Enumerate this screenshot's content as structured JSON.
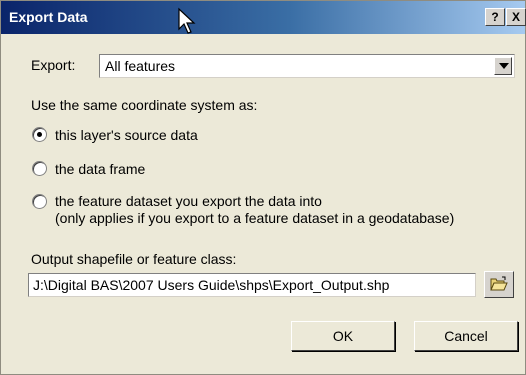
{
  "window": {
    "title": "Export Data",
    "help_label": "?",
    "close_label": "X"
  },
  "export": {
    "label": "Export:",
    "selected": "All features"
  },
  "coordinate_system": {
    "heading": "Use the same coordinate system as:",
    "options": [
      {
        "label": "this layer's source data",
        "selected": true
      },
      {
        "label": "the data frame",
        "selected": false
      },
      {
        "label": "the feature dataset you export the data into",
        "note": "(only applies if you export to a feature dataset in a geodatabase)",
        "selected": false
      }
    ]
  },
  "output": {
    "label": "Output shapefile or feature class:",
    "path": "J:\\Digital BAS\\2007 Users Guide\\shps\\Export_Output.shp"
  },
  "buttons": {
    "ok": "OK",
    "cancel": "Cancel"
  },
  "icons": {
    "browse": "open-folder-icon",
    "cursor": "mouse-pointer-icon"
  }
}
